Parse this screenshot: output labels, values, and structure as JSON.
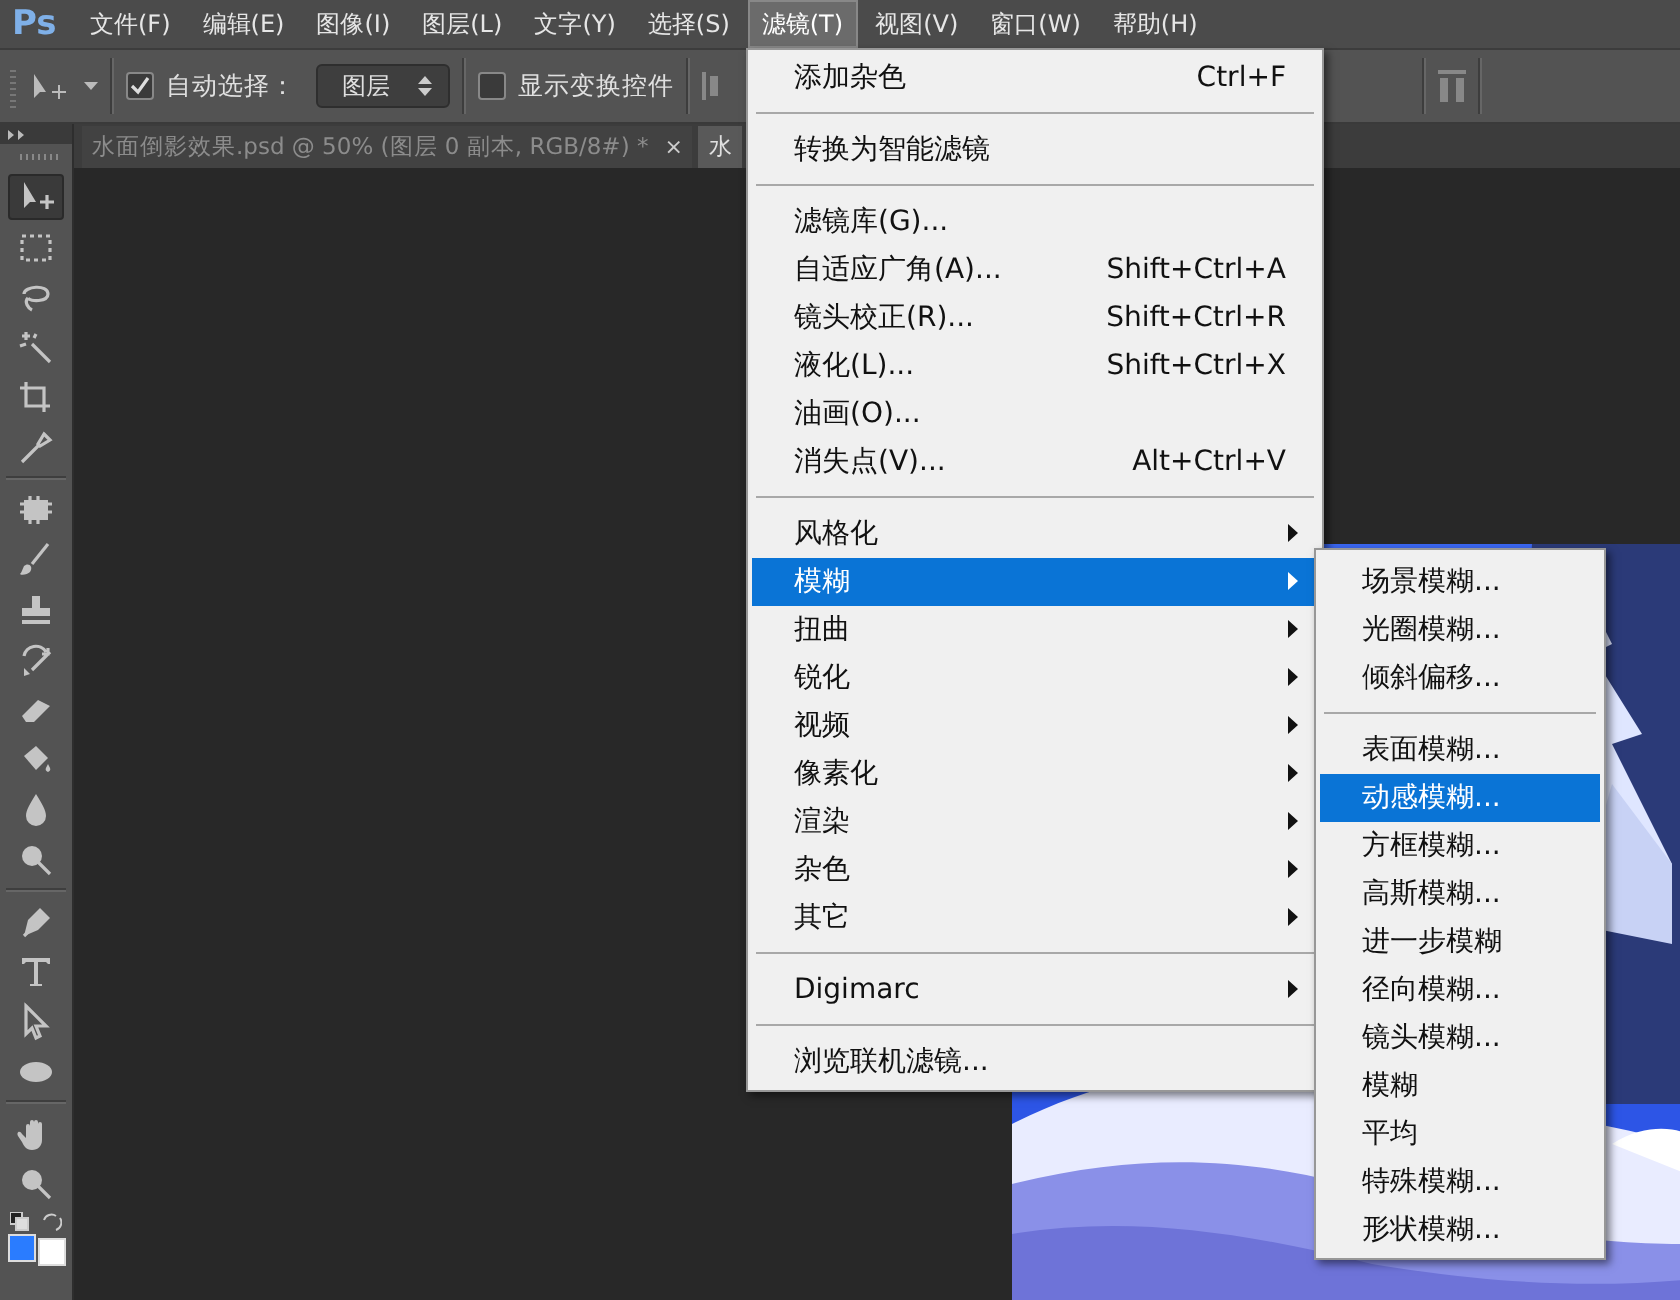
{
  "menubar": {
    "logo": "Ps",
    "items": [
      {
        "label": "文件(F)",
        "selected": false
      },
      {
        "label": "编辑(E)",
        "selected": false
      },
      {
        "label": "图像(I)",
        "selected": false
      },
      {
        "label": "图层(L)",
        "selected": false
      },
      {
        "label": "文字(Y)",
        "selected": false
      },
      {
        "label": "选择(S)",
        "selected": false
      },
      {
        "label": "滤镜(T)",
        "selected": true
      },
      {
        "label": "视图(V)",
        "selected": false
      },
      {
        "label": "窗口(W)",
        "selected": false
      },
      {
        "label": "帮助(H)",
        "selected": false
      }
    ]
  },
  "options_bar": {
    "auto_select": {
      "label": "自动选择：",
      "checked": true
    },
    "layer_dropdown": {
      "value": "图层"
    },
    "show_transform": {
      "label": "显示变换控件",
      "checked": false
    }
  },
  "tabs": [
    {
      "label": "水面倒影效果.psd @ 50% (图层 0 副本, RGB/8#) *",
      "close": "×",
      "selected": false
    },
    {
      "label": "水",
      "selected": true
    }
  ],
  "toolbar": {
    "tools": [
      {
        "selected": true
      },
      {
        "selected": false
      },
      {
        "selected": false
      },
      {
        "selected": false
      },
      {
        "selected": false
      },
      {
        "selected": false
      },
      {
        "selected": false
      },
      {
        "selected": false
      },
      {
        "selected": false
      },
      {
        "selected": false
      },
      {
        "selected": false
      },
      {
        "selected": false
      },
      {
        "selected": false
      },
      {
        "selected": false
      },
      {
        "selected": false
      },
      {
        "selected": false
      },
      {
        "selected": false
      },
      {
        "selected": false
      },
      {
        "selected": false
      },
      {
        "selected": false
      }
    ],
    "color_swatches": [
      {
        "color": "#2a7cff"
      },
      {
        "color": "#ffffff"
      }
    ]
  },
  "filter_menu": {
    "groups": [
      {
        "items": [
          {
            "label": "添加杂色",
            "shortcut": "Ctrl+F",
            "has_submenu": false,
            "selected": false
          }
        ]
      },
      {
        "items": [
          {
            "label": "转换为智能滤镜",
            "has_submenu": false,
            "selected": false
          }
        ]
      },
      {
        "items": [
          {
            "label": "滤镜库(G)...",
            "has_submenu": false,
            "selected": false
          },
          {
            "label": "自适应广角(A)...",
            "shortcut": "Shift+Ctrl+A",
            "has_submenu": false,
            "selected": false
          },
          {
            "label": "镜头校正(R)...",
            "shortcut": "Shift+Ctrl+R",
            "has_submenu": false,
            "selected": false
          },
          {
            "label": "液化(L)...",
            "shortcut": "Shift+Ctrl+X",
            "has_submenu": false,
            "selected": false
          },
          {
            "label": "油画(O)...",
            "has_submenu": false,
            "selected": false
          },
          {
            "label": "消失点(V)...",
            "shortcut": "Alt+Ctrl+V",
            "has_submenu": false,
            "selected": false
          }
        ]
      },
      {
        "items": [
          {
            "label": "风格化",
            "has_submenu": true,
            "selected": false
          },
          {
            "label": "模糊",
            "has_submenu": true,
            "selected": true
          },
          {
            "label": "扭曲",
            "has_submenu": true,
            "selected": false
          },
          {
            "label": "锐化",
            "has_submenu": true,
            "selected": false
          },
          {
            "label": "视频",
            "has_submenu": true,
            "selected": false
          },
          {
            "label": "像素化",
            "has_submenu": true,
            "selected": false
          },
          {
            "label": "渲染",
            "has_submenu": true,
            "selected": false
          },
          {
            "label": "杂色",
            "has_submenu": true,
            "selected": false
          },
          {
            "label": "其它",
            "has_submenu": true,
            "selected": false
          }
        ]
      },
      {
        "items": [
          {
            "label": "Digimarc",
            "has_submenu": true,
            "selected": false
          }
        ]
      },
      {
        "items": [
          {
            "label": "浏览联机滤镜...",
            "has_submenu": false,
            "selected": false
          }
        ]
      }
    ]
  },
  "blur_submenu": {
    "groups": [
      {
        "items": [
          {
            "label": "场景模糊...",
            "selected": false
          },
          {
            "label": "光圈模糊...",
            "selected": false
          },
          {
            "label": "倾斜偏移...",
            "selected": false
          }
        ]
      },
      {
        "items": [
          {
            "label": "表面模糊...",
            "selected": false
          },
          {
            "label": "动感模糊...",
            "selected": true
          },
          {
            "label": "方框模糊...",
            "selected": false
          },
          {
            "label": "高斯模糊...",
            "selected": false
          },
          {
            "label": "进一步模糊",
            "selected": false
          },
          {
            "label": "径向模糊...",
            "selected": false
          },
          {
            "label": "镜头模糊...",
            "selected": false
          },
          {
            "label": "模糊",
            "selected": false
          },
          {
            "label": "平均",
            "selected": false
          },
          {
            "label": "特殊模糊...",
            "selected": false
          },
          {
            "label": "形状模糊...",
            "selected": false
          }
        ]
      }
    ]
  }
}
